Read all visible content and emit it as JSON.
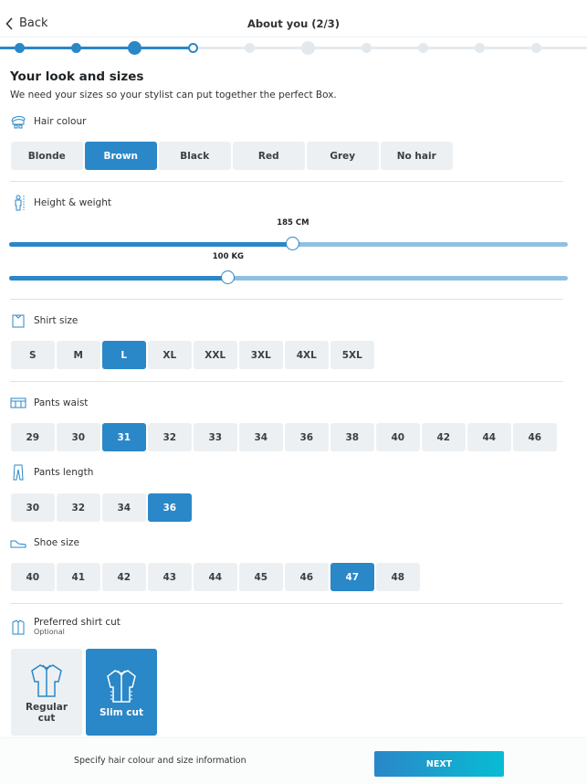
{
  "header": {
    "back_label": "Back",
    "title": "About you (2/3)"
  },
  "progress": {
    "total_steps": 10,
    "current_step": 4,
    "colors": {
      "accent": "#2a87c8",
      "inactive": "#e3e8ec"
    }
  },
  "page": {
    "title": "Your look and sizes",
    "subtitle": "We need your sizes so your stylist can put together the perfect Box."
  },
  "hair": {
    "label": "Hair colour",
    "options": [
      "Blonde",
      "Brown",
      "Black",
      "Red",
      "Grey",
      "No hair"
    ],
    "selected": "Brown"
  },
  "height_weight": {
    "label": "Height & weight",
    "height": {
      "value_label": "185 CM",
      "fraction": 0.508
    },
    "weight": {
      "value_label": "100 KG",
      "fraction": 0.392
    }
  },
  "shirt": {
    "label": "Shirt size",
    "options": [
      "S",
      "M",
      "L",
      "XL",
      "XXL",
      "3XL",
      "4XL",
      "5XL"
    ],
    "selected": "L"
  },
  "waist": {
    "label": "Pants waist",
    "options": [
      "29",
      "30",
      "31",
      "32",
      "33",
      "34",
      "36",
      "38",
      "40",
      "42",
      "44",
      "46"
    ],
    "selected": "31"
  },
  "length": {
    "label": "Pants length",
    "options": [
      "30",
      "32",
      "34",
      "36"
    ],
    "selected": "36"
  },
  "shoe": {
    "label": "Shoe size",
    "options": [
      "40",
      "41",
      "42",
      "43",
      "44",
      "45",
      "46",
      "47",
      "48"
    ],
    "selected": "47"
  },
  "cut": {
    "label": "Preferred shirt cut",
    "optional": "Optional",
    "options": [
      "Regular cut",
      "Slim cut"
    ],
    "selected": "Slim cut"
  },
  "footer": {
    "hint": "Specify hair colour and size information",
    "next_label": "NEXT"
  }
}
